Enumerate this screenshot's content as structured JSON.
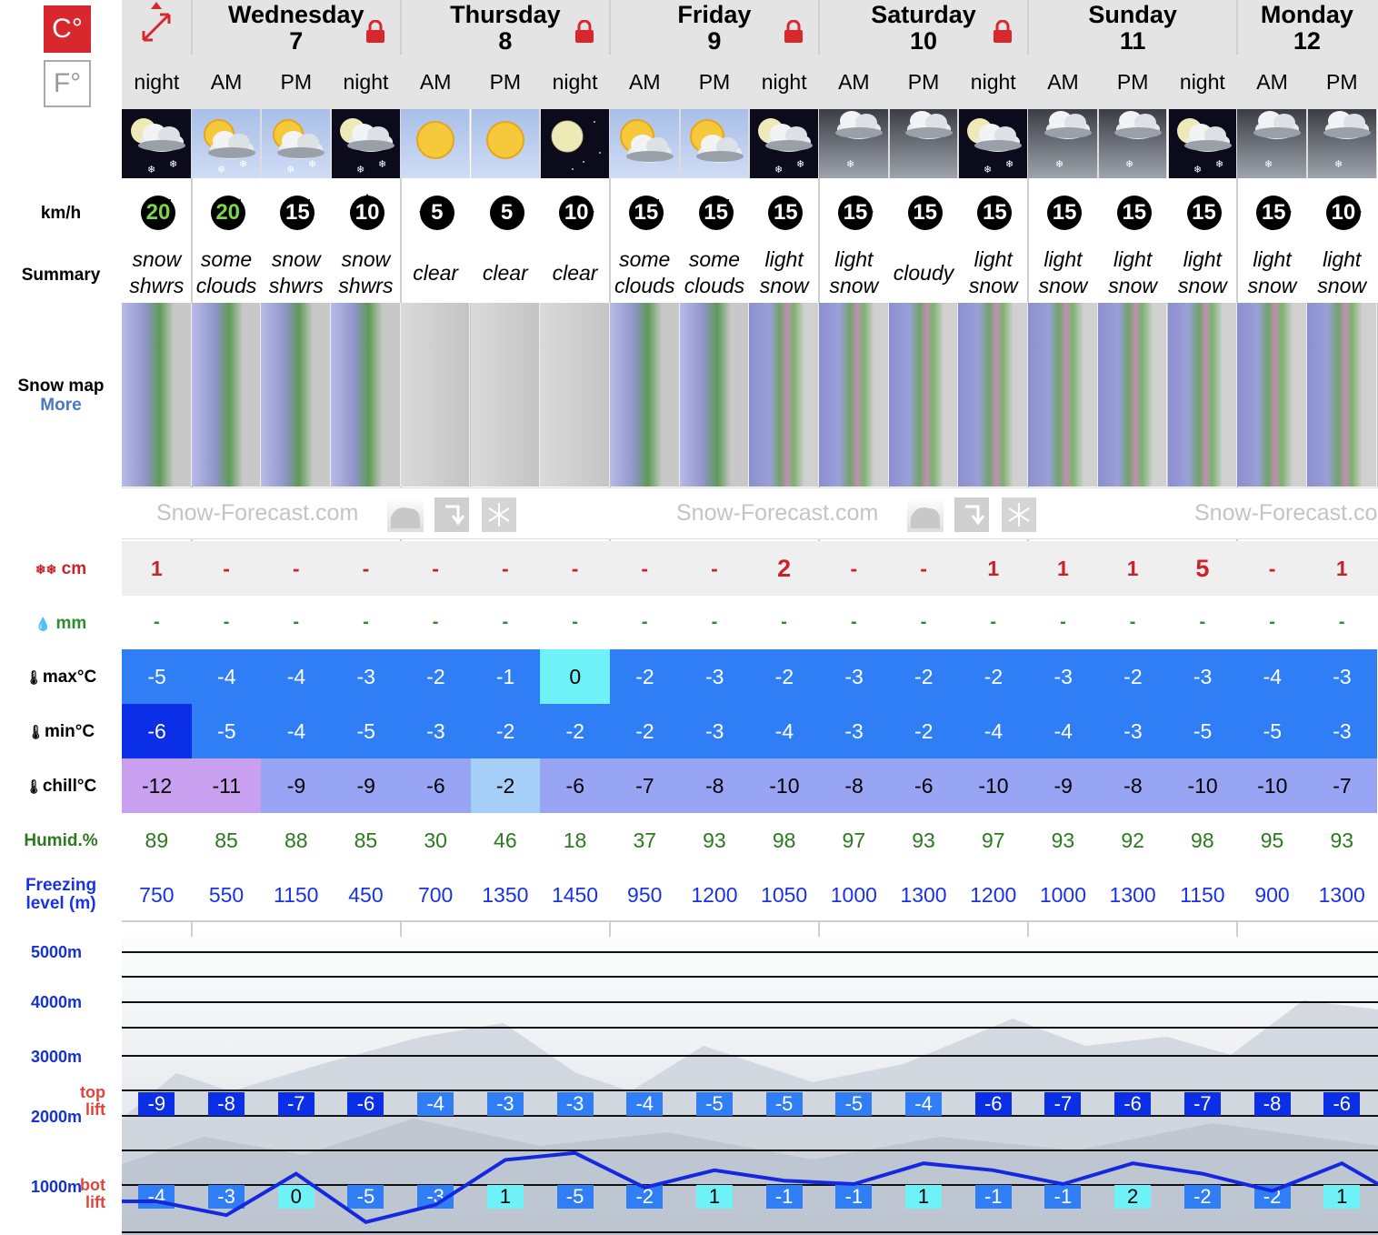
{
  "units": {
    "celsius": "C°",
    "fahrenheit": "F°"
  },
  "days": [
    {
      "name": "",
      "date": "",
      "cols": 1,
      "locked": false
    },
    {
      "name": "Wednesday",
      "date": "7",
      "cols": 3,
      "locked": true
    },
    {
      "name": "Thursday",
      "date": "8",
      "cols": 3,
      "locked": true
    },
    {
      "name": "Friday",
      "date": "9",
      "cols": 3,
      "locked": true
    },
    {
      "name": "Saturday",
      "date": "10",
      "cols": 3,
      "locked": true
    },
    {
      "name": "Sunday",
      "date": "11",
      "cols": 3,
      "locked": false
    },
    {
      "name": "Monday",
      "date": "12",
      "cols": 2,
      "locked": false
    }
  ],
  "labels": {
    "wind_unit": "km/h",
    "summary": "Summary",
    "snow_map": "Snow map",
    "snow_map_more": "More",
    "snow": "cm",
    "rain": "mm",
    "max": "max°C",
    "min": "min°C",
    "chill": "chill°C",
    "humid": "Humid.%",
    "freezing_1": "Freezing",
    "freezing_2": "level (m)",
    "alt_5000": "5000m",
    "alt_4000": "4000m",
    "alt_3000": "3000m",
    "alt_2000": "2000m",
    "alt_1000": "1000m",
    "top_1": "top",
    "top_2": "lift",
    "bot_1": "bot",
    "bot_2": "lift"
  },
  "watermarks": [
    "Snow-Forecast.com",
    "Snow-Forecast.com",
    "Snow-Forecast.co"
  ],
  "periods": [
    {
      "period": "night",
      "icon": "night-cloud-snow-icon",
      "wind": "20",
      "wind_dir": "NE",
      "summary1": "snow",
      "summary2": "shwrs",
      "snow": "1",
      "rain": "-",
      "max": "-5",
      "min": "-6",
      "chill": "-12",
      "humid": "89",
      "freezing": "750",
      "top": "-9",
      "bot": "-4"
    },
    {
      "period": "AM",
      "icon": "sun-cloud-snow-icon",
      "wind": "20",
      "wind_dir": "NE",
      "summary1": "some",
      "summary2": "clouds",
      "snow": "-",
      "rain": "-",
      "max": "-4",
      "min": "-5",
      "chill": "-11",
      "humid": "85",
      "freezing": "550",
      "top": "-8",
      "bot": "-3"
    },
    {
      "period": "PM",
      "icon": "sun-cloud-snow-icon",
      "wind": "15",
      "wind_dir": "NE",
      "summary1": "snow",
      "summary2": "shwrs",
      "snow": "-",
      "rain": "-",
      "max": "-4",
      "min": "-4",
      "chill": "-9",
      "humid": "88",
      "freezing": "1150",
      "top": "-7",
      "bot": "0"
    },
    {
      "period": "night",
      "icon": "night-cloud-snow-icon",
      "wind": "10",
      "wind_dir": "N",
      "summary1": "snow",
      "summary2": "shwrs",
      "snow": "-",
      "rain": "-",
      "max": "-3",
      "min": "-5",
      "chill": "-9",
      "humid": "85",
      "freezing": "450",
      "top": "-6",
      "bot": "-5"
    },
    {
      "period": "AM",
      "icon": "sun-icon",
      "wind": "5",
      "wind_dir": "W",
      "summary1": "clear",
      "summary2": "",
      "snow": "-",
      "rain": "-",
      "max": "-2",
      "min": "-3",
      "chill": "-6",
      "humid": "30",
      "freezing": "700",
      "top": "-4",
      "bot": "-3"
    },
    {
      "period": "PM",
      "icon": "sun-icon",
      "wind": "5",
      "wind_dir": "SW",
      "summary1": "clear",
      "summary2": "",
      "snow": "-",
      "rain": "-",
      "max": "-1",
      "min": "-2",
      "chill": "-2",
      "humid": "46",
      "freezing": "1350",
      "top": "-3",
      "bot": "1"
    },
    {
      "period": "night",
      "icon": "moon-icon",
      "wind": "10",
      "wind_dir": "E",
      "summary1": "clear",
      "summary2": "",
      "snow": "-",
      "rain": "-",
      "max": "0",
      "min": "-2",
      "chill": "-6",
      "humid": "18",
      "freezing": "1450",
      "top": "-3",
      "bot": "-5"
    },
    {
      "period": "AM",
      "icon": "sun-cloud-icon",
      "wind": "15",
      "wind_dir": "NE",
      "summary1": "some",
      "summary2": "clouds",
      "snow": "-",
      "rain": "-",
      "max": "-2",
      "min": "-2",
      "chill": "-7",
      "humid": "37",
      "freezing": "950",
      "top": "-4",
      "bot": "-2"
    },
    {
      "period": "PM",
      "icon": "sun-cloud-icon",
      "wind": "15",
      "wind_dir": "NE",
      "summary1": "some",
      "summary2": "clouds",
      "snow": "-",
      "rain": "-",
      "max": "-3",
      "min": "-3",
      "chill": "-8",
      "humid": "93",
      "freezing": "1200",
      "top": "-5",
      "bot": "1"
    },
    {
      "period": "night",
      "icon": "night-cloud-snow-icon",
      "wind": "15",
      "wind_dir": "SE",
      "summary1": "light",
      "summary2": "snow",
      "snow": "2",
      "rain": "-",
      "max": "-2",
      "min": "-4",
      "chill": "-10",
      "humid": "98",
      "freezing": "1050",
      "top": "-5",
      "bot": "-1"
    },
    {
      "period": "AM",
      "icon": "cloud-snow-icon",
      "wind": "15",
      "wind_dir": "E",
      "summary1": "light",
      "summary2": "snow",
      "snow": "-",
      "rain": "-",
      "max": "-3",
      "min": "-3",
      "chill": "-8",
      "humid": "97",
      "freezing": "1000",
      "top": "-5",
      "bot": "-1"
    },
    {
      "period": "PM",
      "icon": "cloud-icon",
      "wind": "15",
      "wind_dir": "SE",
      "summary1": "cloudy",
      "summary2": "",
      "snow": "-",
      "rain": "-",
      "max": "-2",
      "min": "-2",
      "chill": "-6",
      "humid": "93",
      "freezing": "1300",
      "top": "-4",
      "bot": "1"
    },
    {
      "period": "night",
      "icon": "night-cloud-snow-icon",
      "wind": "15",
      "wind_dir": "SE",
      "summary1": "light",
      "summary2": "snow",
      "snow": "1",
      "rain": "-",
      "max": "-2",
      "min": "-4",
      "chill": "-10",
      "humid": "97",
      "freezing": "1200",
      "top": "-6",
      "bot": "-1"
    },
    {
      "period": "AM",
      "icon": "cloud-snow-icon",
      "wind": "15",
      "wind_dir": "SE",
      "summary1": "light",
      "summary2": "snow",
      "snow": "1",
      "rain": "-",
      "max": "-3",
      "min": "-4",
      "chill": "-9",
      "humid": "93",
      "freezing": "1000",
      "top": "-7",
      "bot": "-1"
    },
    {
      "period": "PM",
      "icon": "cloud-snow-icon",
      "wind": "15",
      "wind_dir": "SE",
      "summary1": "light",
      "summary2": "snow",
      "snow": "1",
      "rain": "-",
      "max": "-2",
      "min": "-3",
      "chill": "-8",
      "humid": "92",
      "freezing": "1300",
      "top": "-6",
      "bot": "2"
    },
    {
      "period": "night",
      "icon": "night-cloud-snow-icon",
      "wind": "15",
      "wind_dir": "SE",
      "summary1": "light",
      "summary2": "snow",
      "snow": "5",
      "rain": "-",
      "max": "-3",
      "min": "-5",
      "chill": "-10",
      "humid": "98",
      "freezing": "1150",
      "top": "-7",
      "bot": "-2"
    },
    {
      "period": "AM",
      "icon": "cloud-snow-icon",
      "wind": "15",
      "wind_dir": "E",
      "summary1": "light",
      "summary2": "snow",
      "snow": "-",
      "rain": "-",
      "max": "-4",
      "min": "-5",
      "chill": "-10",
      "humid": "95",
      "freezing": "900",
      "top": "-8",
      "bot": "-2"
    },
    {
      "period": "PM",
      "icon": "cloud-snow-icon",
      "wind": "10",
      "wind_dir": "E",
      "summary1": "light",
      "summary2": "snow",
      "snow": "1",
      "rain": "-",
      "max": "-3",
      "min": "-3",
      "chill": "-7",
      "humid": "93",
      "freezing": "1300",
      "top": "-6",
      "bot": "1"
    }
  ],
  "colors": {
    "brand_red": "#d9272e",
    "snow_red": "#c8232a",
    "rain_green": "#2e8b2e",
    "humid_green": "#2c7a1f",
    "freezing_blue": "#1a32e6",
    "altitude_blue": "#1532d6",
    "freeze_line": "#1428e0"
  }
}
